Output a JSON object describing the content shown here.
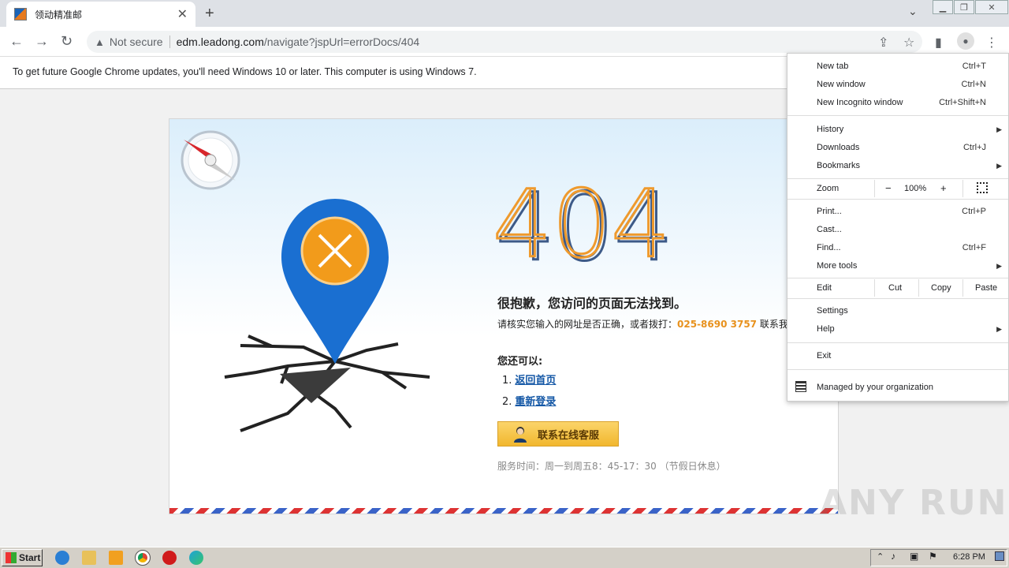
{
  "browser": {
    "tab_title": "领动精准邮",
    "tab_close": "✕",
    "new_tab": "+",
    "address": {
      "security": "Not secure",
      "host": "edm.leadong.com",
      "path": "/navigate?jspUrl=errorDocs/404"
    },
    "infobar": "To get future Google Chrome updates, you'll need Windows 10 or later. This computer is using Windows 7."
  },
  "page": {
    "code": "404",
    "headline": "很抱歉，您访问的页面无法找到。",
    "sub_prefix": "请核实您输入的网址是否正确，或者拨打：",
    "phone": "025-8690 3757",
    "sub_suffix": " 联系我们",
    "also_label": "您还可以:",
    "links": [
      {
        "num": "1.",
        "label": "返回首页"
      },
      {
        "num": "2.",
        "label": "重新登录"
      }
    ],
    "cs_button": "联系在线客服",
    "hours": "服务时间：周一到周五8：45-17：30 （节假日休息）"
  },
  "menu": {
    "items_top": [
      {
        "label": "New tab",
        "shortcut": "Ctrl+T"
      },
      {
        "label": "New window",
        "shortcut": "Ctrl+N"
      },
      {
        "label": "New Incognito window",
        "shortcut": "Ctrl+Shift+N"
      }
    ],
    "items_mid": [
      {
        "label": "History",
        "shortcut": ""
      },
      {
        "label": "Downloads",
        "shortcut": "Ctrl+J"
      },
      {
        "label": "Bookmarks",
        "shortcut": ""
      }
    ],
    "zoom": {
      "label": "Zoom",
      "minus": "−",
      "value": "100%",
      "plus": "+"
    },
    "items_tools": [
      {
        "label": "Print...",
        "shortcut": "Ctrl+P"
      },
      {
        "label": "Cast...",
        "shortcut": ""
      },
      {
        "label": "Find...",
        "shortcut": "Ctrl+F"
      },
      {
        "label": "More tools",
        "shortcut": ""
      }
    ],
    "edit": {
      "label": "Edit",
      "cut": "Cut",
      "copy": "Copy",
      "paste": "Paste"
    },
    "settings": "Settings",
    "help": "Help",
    "exit": "Exit",
    "managed": "Managed by your organization"
  },
  "taskbar": {
    "start": "Start",
    "clock": "6:28 PM"
  },
  "watermark": "ANY RUN"
}
